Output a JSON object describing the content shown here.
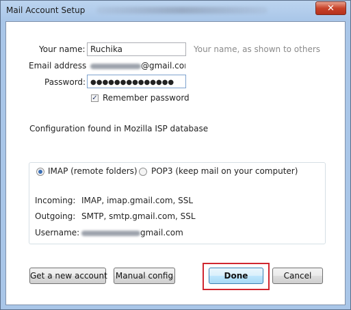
{
  "window": {
    "title": "Mail Account Setup",
    "close_glyph": "✕"
  },
  "form": {
    "name_label": "Your name:",
    "name_value": "Ruchika",
    "name_hint": "Your name, as shown to others",
    "email_label": "Email address:",
    "email_value_suffix": "@gmail.com",
    "password_label": "Password:",
    "password_value": "●●●●●●●●●●●●●●",
    "remember_label": "Remember password",
    "remember_checked": true
  },
  "config_status": "Configuration found in Mozilla ISP database",
  "server": {
    "imap_label": "IMAP (remote folders)",
    "pop3_label": "POP3 (keep mail on your computer)",
    "selected": "IMAP",
    "incoming_label": "Incoming:",
    "incoming_value": "IMAP, imap.gmail.com, SSL",
    "outgoing_label": "Outgoing:",
    "outgoing_value": "SMTP, smtp.gmail.com, SSL",
    "username_label": "Username:",
    "username_value_suffix": "gmail.com"
  },
  "buttons": {
    "new_account": "Get a new account",
    "manual_config": "Manual config",
    "done": "Done",
    "cancel": "Cancel"
  },
  "colors": {
    "highlight": "#d0262f",
    "close_button": "#c8432a",
    "title_bar": "#a9c6e8"
  }
}
